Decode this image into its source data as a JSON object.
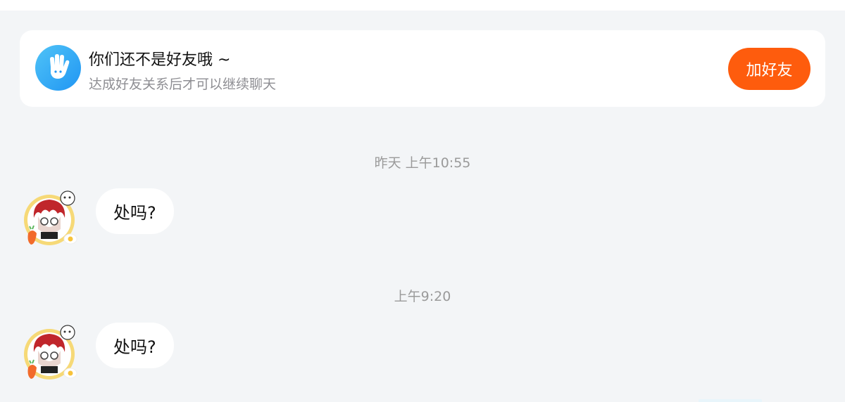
{
  "notice": {
    "title": "你们还不是好友哦 ~",
    "subtitle": "达成好友关系后才可以继续聊天",
    "action_label": "加好友",
    "accent_color": "#fe5c0d",
    "icon": "waving-hand-icon"
  },
  "messages": [
    {
      "timestamp": "昨天 上午10:55",
      "text": "处吗?",
      "sender": "other"
    },
    {
      "timestamp": "上午9:20",
      "text": "处吗?",
      "sender": "other"
    }
  ]
}
